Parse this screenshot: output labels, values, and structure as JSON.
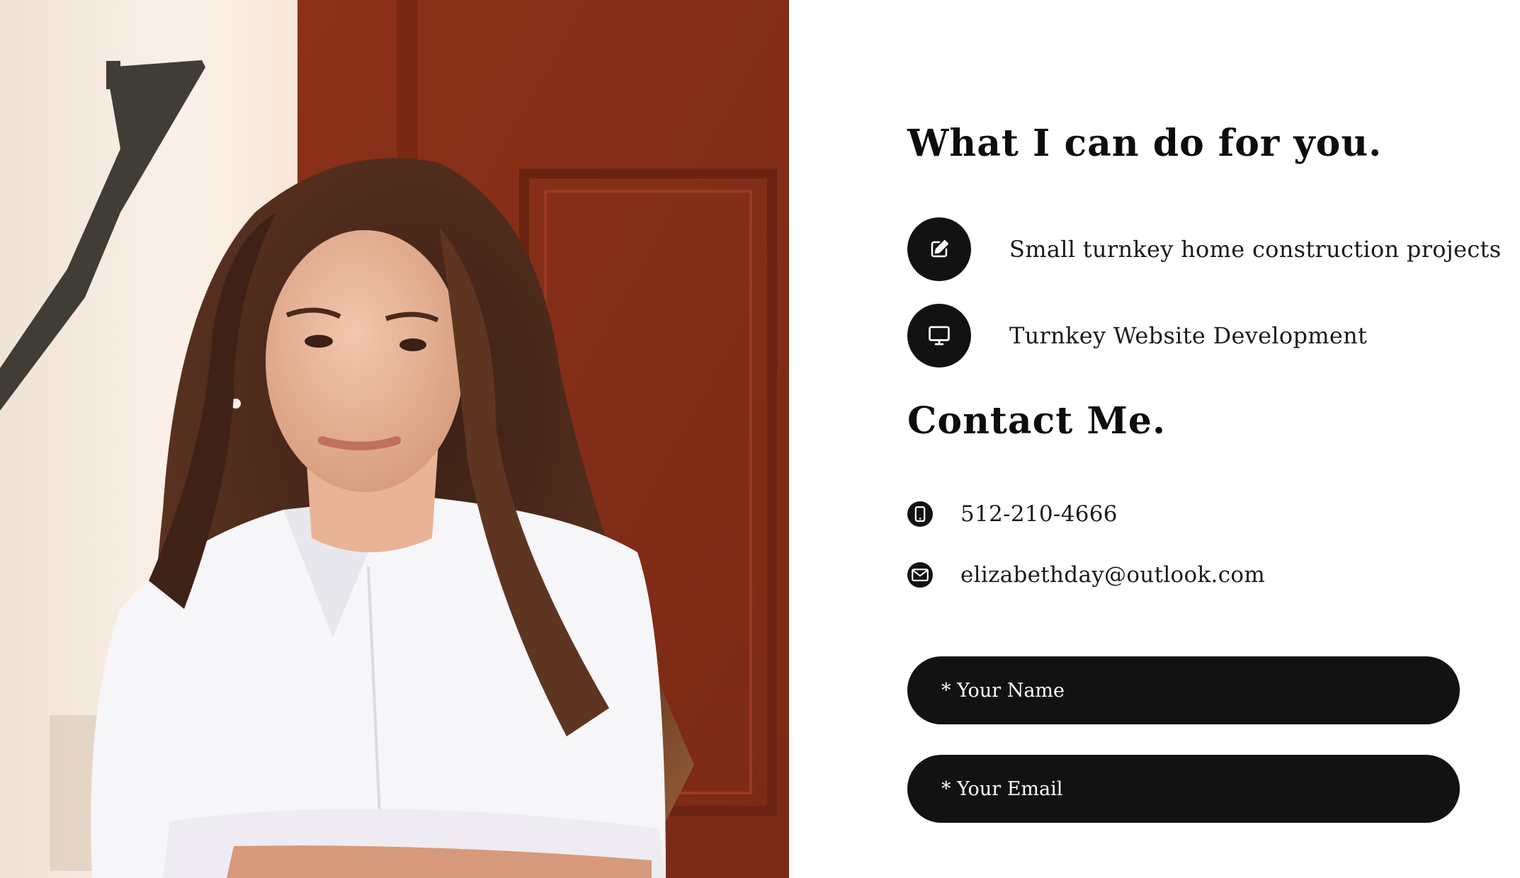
{
  "services": {
    "heading": "What I can do for you.",
    "items": [
      {
        "icon": "edit-icon",
        "label": "Small turnkey home construction projects"
      },
      {
        "icon": "monitor-icon",
        "label": "Turnkey Website Development"
      }
    ]
  },
  "contact": {
    "heading": "Contact Me.",
    "phone": {
      "icon": "mobile-phone-icon",
      "value": "512-210-4666"
    },
    "email": {
      "icon": "envelope-icon",
      "value": "elizabethday@outlook.com"
    }
  },
  "form": {
    "name_placeholder": "* Your Name",
    "email_placeholder": "* Your Email"
  },
  "colors": {
    "text": "#111111",
    "accent_dark": "#121212",
    "background": "#ffffff",
    "door_red": "#8a2f1a"
  }
}
